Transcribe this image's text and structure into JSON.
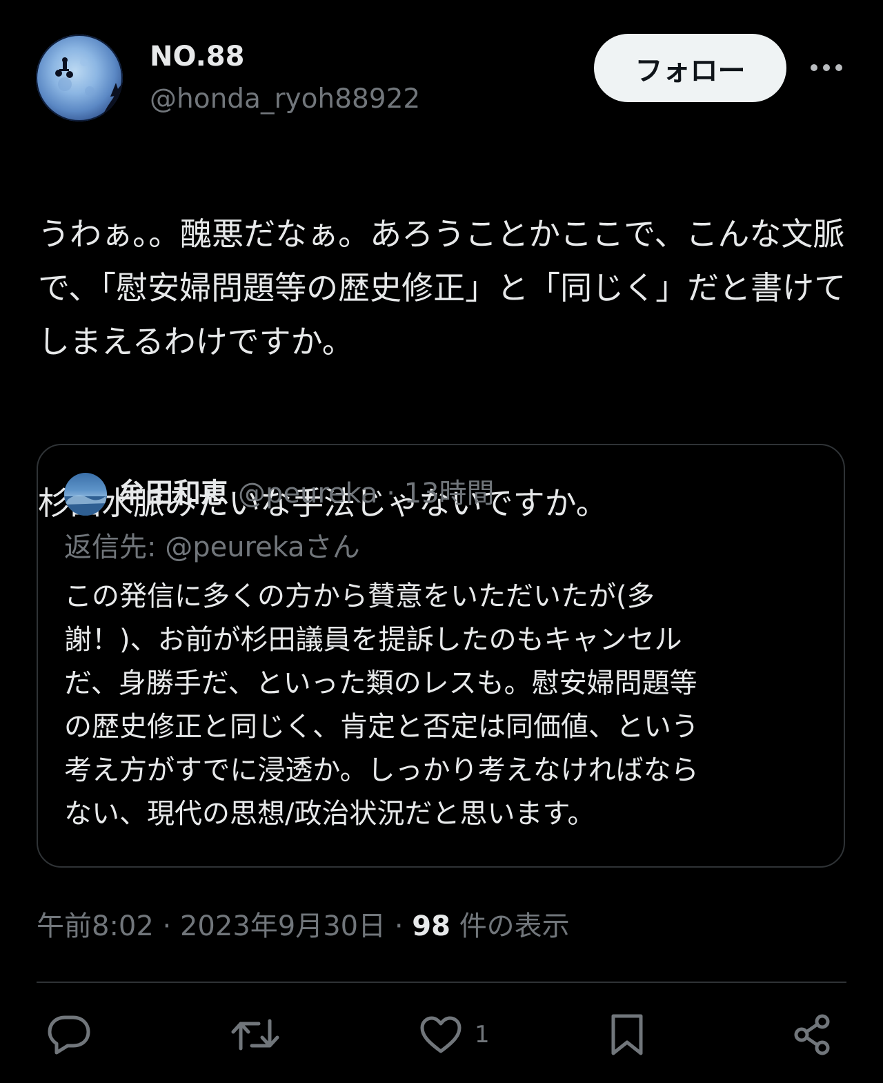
{
  "author": {
    "display_name": "NO.88",
    "handle": "@honda_ryoh88922",
    "avatar_icon": "moon-bicycle-avatar"
  },
  "header": {
    "follow_label": "フォロー",
    "more_icon": "more-horizontal-icon"
  },
  "tweet": {
    "paragraphs": [
      "うわぁ。。醜悪だなぁ。あろうことかここで、こんな文脈で、「慰安婦問題等の歴史修正」と「同じく」だと書けてしまえるわけですか。",
      "杉田水脈みたいな手法じゃないですか。"
    ]
  },
  "quoted": {
    "display_name": "牟田和恵",
    "handle": "@peureka",
    "separator": "·",
    "time": "13時間",
    "replying_to": "返信先: @peurekaさん",
    "text_lines": [
      "この発信に多くの方から賛意をいただいたが(多",
      "謝！)、お前が杉田議員を提訴したのもキャンセル",
      "だ、身勝手だ、といった類のレスも。慰安婦問題等",
      "の歴史修正と同じく、肯定と否定は同価値、という",
      "考え方がすでに浸透か。しっかり考えなければなら",
      "ない、現代の思想/政治状況だと思います。"
    ]
  },
  "meta": {
    "time": "午前8:02",
    "separator": "·",
    "date": "2023年9月30日",
    "views_count": "98",
    "views_label": "件の表示"
  },
  "actions": {
    "reply_icon": "reply-icon",
    "retweet_icon": "retweet-icon",
    "like_icon": "heart-icon",
    "like_count": "1",
    "bookmark_icon": "bookmark-icon",
    "share_icon": "share-icon"
  },
  "colors": {
    "background": "#000000",
    "text_primary": "#e7e9ea",
    "text_secondary": "#71767b",
    "border": "#2f3336",
    "follow_bg": "#eff3f4"
  }
}
